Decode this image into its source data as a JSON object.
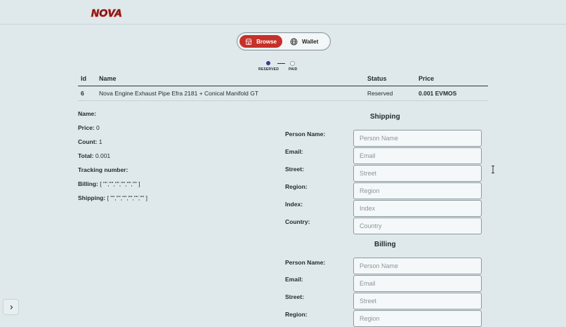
{
  "brand": {
    "logo_text": "NOVA"
  },
  "nav": {
    "browse_label": "Browse",
    "wallet_label": "Wallet",
    "active": "Browse",
    "browse_icon": "store-icon",
    "wallet_icon": "globe-icon"
  },
  "progress": {
    "steps": [
      "RESERVED",
      "PAID"
    ],
    "current": "RESERVED"
  },
  "table": {
    "headers": [
      "Id",
      "Name",
      "Status",
      "Price"
    ],
    "rows": [
      {
        "id": "6",
        "name": "Nova Engine Exhaust Pipe Efra 2181 + Conical Manifold GT",
        "status": "Reserved",
        "price": "0.001 EVMOS"
      }
    ]
  },
  "details": {
    "name_label": "Name:",
    "name_value": "",
    "price_label": "Price:",
    "price_value": "0",
    "count_label": "Count:",
    "count_value": "1",
    "total_label": "Total:",
    "total_value": "0.001",
    "tracking_label": "Tracking number:",
    "tracking_value": "",
    "billing_label": "Billing:",
    "billing_value": "[ \"\",\"\",\"\",\"\",\"\",\"\" ]",
    "shipping_label": "Shipping:",
    "shipping_value": "[ \"\",\"\",\"\",\"\",\"\",\"\" ]"
  },
  "shipping": {
    "title": "Shipping",
    "fields": [
      {
        "label": "Person Name:",
        "placeholder": "Person Name",
        "value": ""
      },
      {
        "label": "Email:",
        "placeholder": "Email",
        "value": ""
      },
      {
        "label": "Street:",
        "placeholder": "Street",
        "value": ""
      },
      {
        "label": "Region:",
        "placeholder": "Region",
        "value": ""
      },
      {
        "label": "Index:",
        "placeholder": "Index",
        "value": ""
      },
      {
        "label": "Country:",
        "placeholder": "Country",
        "value": ""
      }
    ]
  },
  "billing": {
    "title": "Billing",
    "fields": [
      {
        "label": "Person Name:",
        "placeholder": "Person Name",
        "value": ""
      },
      {
        "label": "Email:",
        "placeholder": "Email",
        "value": ""
      },
      {
        "label": "Street:",
        "placeholder": "Street",
        "value": ""
      },
      {
        "label": "Region:",
        "placeholder": "Region",
        "value": ""
      }
    ]
  },
  "colors": {
    "accent": "#c6312a",
    "background": "#dfe9ec",
    "step_active": "#3d3a8f"
  }
}
